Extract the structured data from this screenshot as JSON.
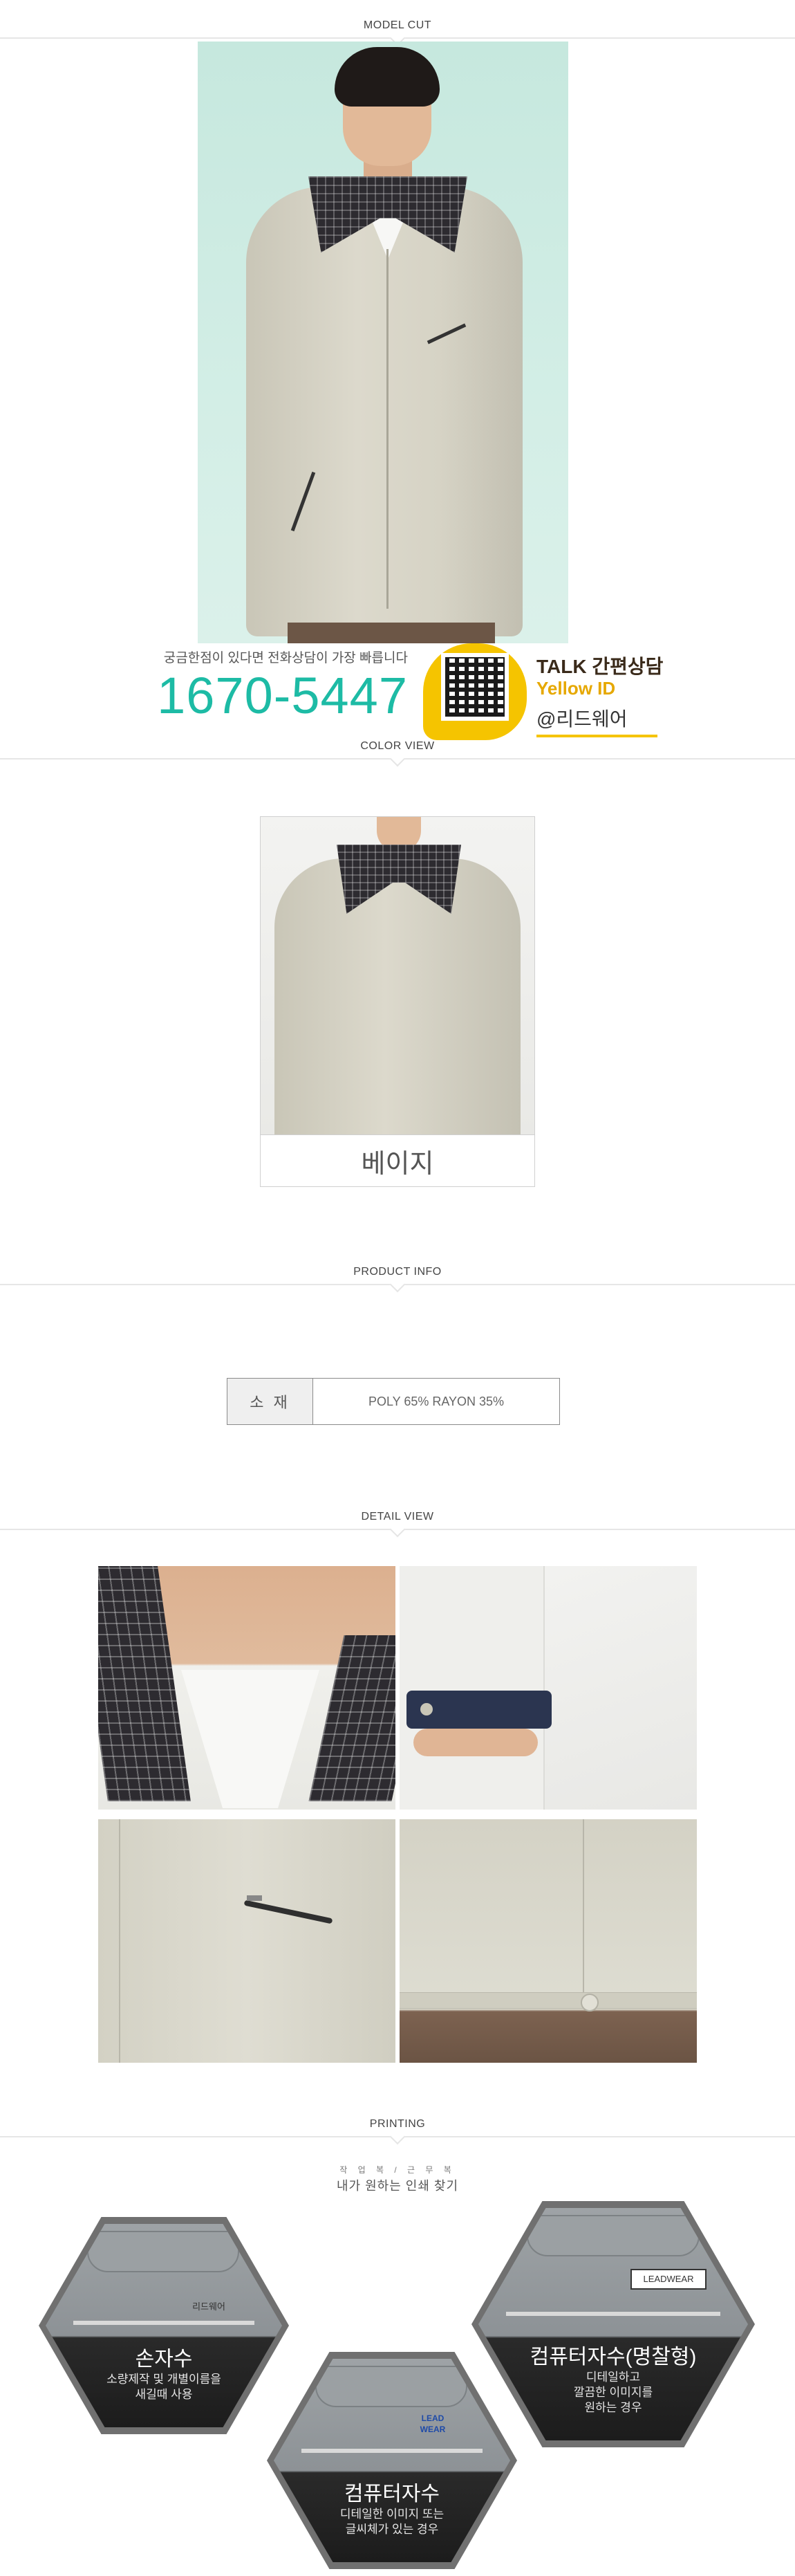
{
  "sections": {
    "model_cut": "MODEL CUT",
    "color_view": "COLOR VIEW",
    "product_info": "PRODUCT INFO",
    "detail_view": "DETAIL VIEW",
    "printing": "PRINTING"
  },
  "contact": {
    "tagline": "궁금한점이 있다면 전화상담이 가장 빠릅니다",
    "phone": "1670-5447",
    "talk_line1": "TALK 간편상담",
    "talk_line2": "Yellow ID",
    "talk_line3": "@리드웨어"
  },
  "color_view": {
    "colors": [
      "베이지"
    ]
  },
  "product_info": {
    "material_key": "소 재",
    "material_value": "POLY 65% RAYON 35%"
  },
  "printing": {
    "subtitle_small": "작 업 복 / 근 무 복",
    "subtitle": "내가 원하는 인쇄 찾기",
    "options": [
      {
        "title": "손자수",
        "desc1": "소량제작 및 개별이름을",
        "desc2": "새길때 사용",
        "patch": "리드웨어"
      },
      {
        "title": "컴퓨터자수",
        "desc1": "디테일한 이미지 또는",
        "desc2": "글씨체가 있는 경우",
        "patch": "LEAD WEAR"
      },
      {
        "title": "컴퓨터자수(명찰형)",
        "desc1": "디테일하고",
        "desc2": "깔끔한 이미지를",
        "desc3": "원하는 경우",
        "patch": "LEADWEAR"
      }
    ]
  },
  "colors": {
    "accent_phone": "#1dbba5",
    "kakao_yellow": "#f5c400",
    "jacket_beige": "#d6d3c5",
    "collar_check": "#2d2b30"
  },
  "icons": {
    "qr": "qr-code-icon",
    "kakao": "kakao-talk-icon"
  }
}
